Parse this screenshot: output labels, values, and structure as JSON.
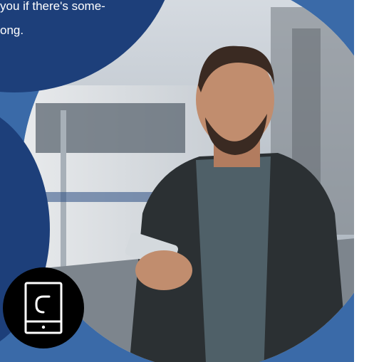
{
  "texts": {
    "line_1": "you if there's some-",
    "line_2": "ong."
  },
  "colors": {
    "background": "#3a6aa8",
    "bubble": "#1d3f7a",
    "badge": "#000000",
    "accent_band": "#ffffff"
  },
  "icons": {
    "badge_icon": "mobile-phone-icon"
  }
}
